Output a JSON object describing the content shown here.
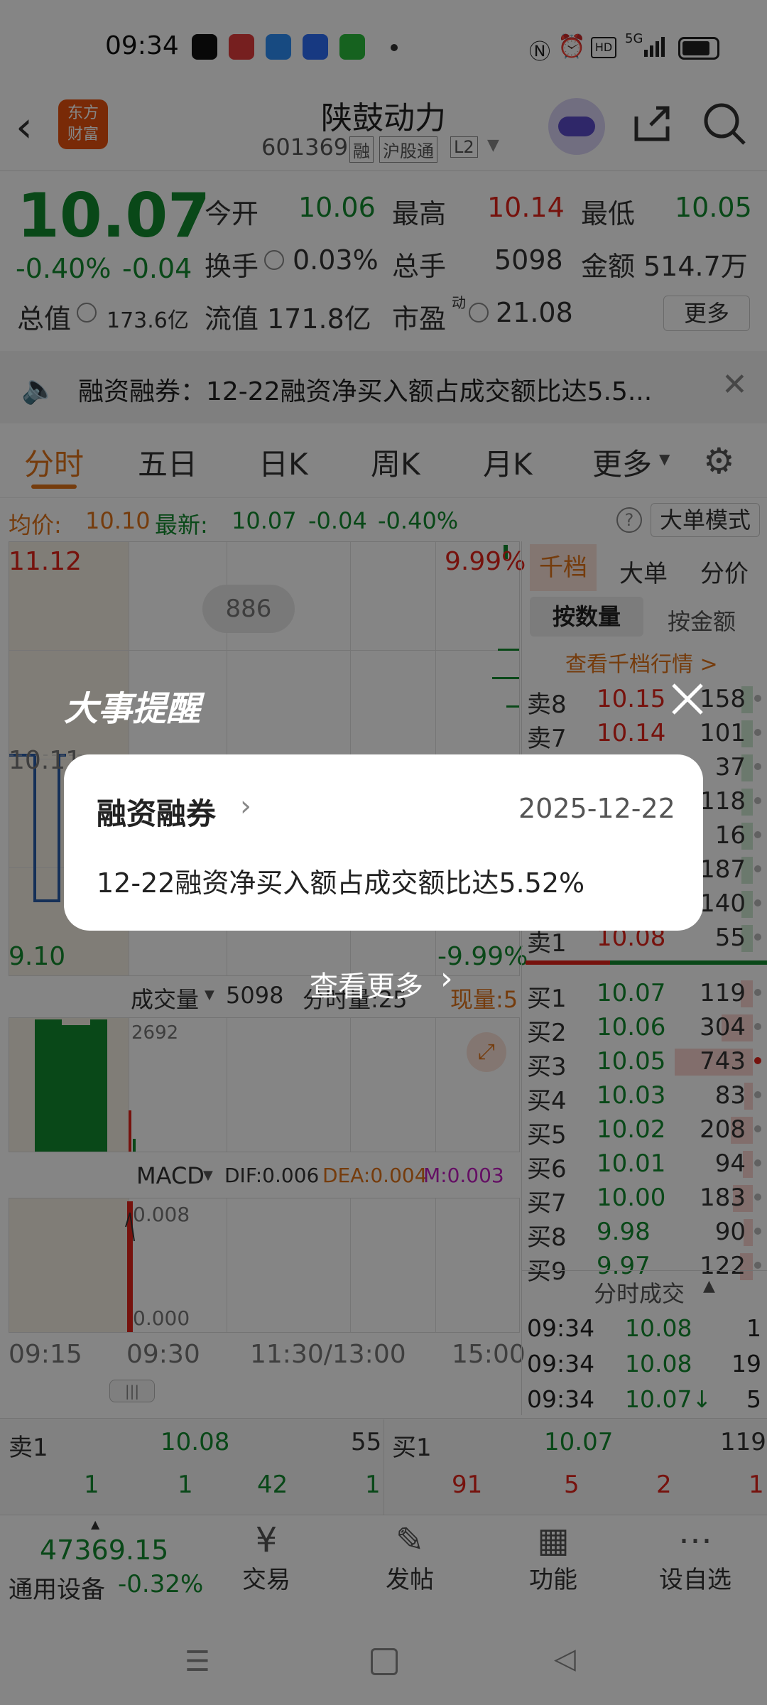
{
  "status_bar": {
    "time": "09:34",
    "net": "5G"
  },
  "header": {
    "name": "陕鼓动力",
    "code": "601369",
    "tags": [
      "融",
      "沪股通",
      "L2"
    ],
    "logo_text_1": "东方",
    "logo_text_2": "财富"
  },
  "quote": {
    "price": "10.07",
    "change_pct": "-0.40%",
    "change": "-0.04",
    "open_label": "今开",
    "open": "10.06",
    "high_label": "最高",
    "high": "10.14",
    "low_label": "最低",
    "low": "10.05",
    "turnover_label": "换手",
    "turnover": "0.03%",
    "volume_label": "总手",
    "volume": "5098",
    "amount_label": "金额",
    "amount": "514.7万",
    "mcap_label": "总值",
    "mcap": "173.6亿",
    "float_label": "流值",
    "float": "171.8亿",
    "pe_label": "市盈",
    "pe_sup": "动",
    "pe": "21.08",
    "more_label": "更多"
  },
  "news_banner": {
    "text": "融资融券：12-22融资净买入额占成交额比达5.5..."
  },
  "tabs": [
    "分时",
    "五日",
    "日K",
    "周K",
    "月K",
    "更多"
  ],
  "chart_info": {
    "avg_label": "均价:",
    "avg": "10.10",
    "latest_label": "最新:",
    "latest": "10.07",
    "latest_chg": "-0.04",
    "latest_pct": "-0.40%",
    "mode_button": "大单模式",
    "top_price": "11.12",
    "top_pct": "9.99%",
    "bottom_price": "9.10",
    "bottom_pct": "-9.99%",
    "mid_price": "10.11",
    "bubble": "886",
    "vol_label": "成交量",
    "vol_value": "5098",
    "vol_peak": "2692",
    "fenshi_label": "分时量:25",
    "xianliang_label": "现量:5",
    "macd_label": "MACD",
    "dif": "DIF:0.006",
    "dea": "DEA:0.004",
    "m": "M:0.003",
    "macd_top": "0.008",
    "macd_bottom": "0.000",
    "times": [
      "09:15",
      "09:30",
      "11:30/13:00",
      "15:00"
    ]
  },
  "orderbook": {
    "tabs": [
      "千档",
      "大单",
      "分价"
    ],
    "sub_tabs": [
      "按数量",
      "按金额"
    ],
    "link": "查看千档行情 >",
    "asks": [
      {
        "label": "卖8",
        "price": "10.15",
        "vol": "158"
      },
      {
        "label": "卖7",
        "price": "10.14",
        "vol": "101"
      },
      {
        "label": "",
        "price": "",
        "vol": "37"
      },
      {
        "label": "",
        "price": "",
        "vol": "118"
      },
      {
        "label": "",
        "price": "",
        "vol": "16"
      },
      {
        "label": "",
        "price": "",
        "vol": "187"
      },
      {
        "label": "",
        "price": "",
        "vol": "140"
      },
      {
        "label": "卖1",
        "price": "10.08",
        "vol": "55"
      }
    ],
    "bids": [
      {
        "label": "买1",
        "price": "10.07",
        "vol": "119"
      },
      {
        "label": "买2",
        "price": "10.06",
        "vol": "304"
      },
      {
        "label": "买3",
        "price": "10.05",
        "vol": "743"
      },
      {
        "label": "买4",
        "price": "10.03",
        "vol": "83"
      },
      {
        "label": "买5",
        "price": "10.02",
        "vol": "208"
      },
      {
        "label": "买6",
        "price": "10.01",
        "vol": "94"
      },
      {
        "label": "买7",
        "price": "10.00",
        "vol": "183"
      },
      {
        "label": "买8",
        "price": "9.98",
        "vol": "90"
      },
      {
        "label": "买9",
        "price": "9.97",
        "vol": "122"
      }
    ],
    "bid_levels": [
      0.15,
      0.4,
      1.0,
      0.11,
      0.28,
      0.13,
      0.25,
      0.12,
      0.16
    ],
    "trades_title": "分时成交",
    "trades": [
      {
        "time": "09:34",
        "price": "10.08",
        "vol": "1"
      },
      {
        "time": "09:34",
        "price": "10.08",
        "vol": "19"
      },
      {
        "time": "09:34",
        "price": "10.07↓",
        "vol": "5"
      }
    ]
  },
  "bottom_quote": {
    "sell_label": "卖1",
    "sell_price": "10.08",
    "sell_vol": "55",
    "buy_label": "买1",
    "buy_price": "10.07",
    "buy_vol": "119",
    "sell_queue": [
      "1",
      "1",
      "42",
      "1"
    ],
    "buy_queue": [
      "91",
      "5",
      "2",
      "1"
    ]
  },
  "bottom_nav": {
    "index_value": "47369.15",
    "index_name": "通用设备",
    "index_change": "-0.32%",
    "items": [
      "交易",
      "发帖",
      "功能",
      "设自选"
    ]
  },
  "modal": {
    "heading": "大事提醒",
    "category": "融资融券",
    "date": "2025-12-22",
    "body": "12-22融资净买入额占成交额比达5.52%",
    "more": "查看更多"
  },
  "colors": {
    "up": "#e2231a",
    "down": "#138a2e",
    "accent": "#e0741a",
    "overlay": "rgba(0,0,0,0.48)"
  }
}
